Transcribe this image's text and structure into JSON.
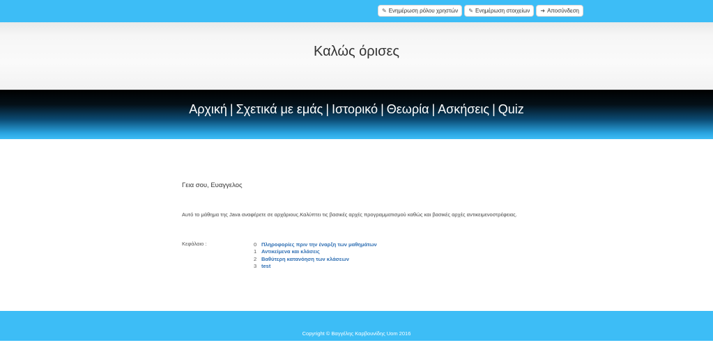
{
  "topbar": {
    "buttons": [
      {
        "label": "Ενημέρωση ρόλου χρηστών",
        "icon": "pencil-icon"
      },
      {
        "label": "Ενημέρωση στοιχείων",
        "icon": "pencil-icon"
      },
      {
        "label": "Αποσύνδεση",
        "icon": "logout-icon"
      }
    ],
    "color": "#3dbdf6"
  },
  "hero": {
    "title": "Καλώς όρισες"
  },
  "nav": {
    "items": [
      "Αρχική",
      "Σχετικά με εμάς",
      "Ιστορικό",
      "Θεωρία",
      "Ασκήσεις",
      "Quiz"
    ],
    "separator": "|"
  },
  "main": {
    "greeting": "Γεια σου, Ευαγγελος",
    "description": "Αυτό το μάθημα της Java αναφέρετε σε αρχάριους.Καλύπτει τις βασικές αρχές προγραμματισμού καθώς και βασικές αρχές αντικειμενοστρέφειας.",
    "chapters_label": "Κεφάλαιο :",
    "chapters": [
      {
        "num": "0",
        "title": "Πληροφορίες πριν την έναρξη των μαθημάτων"
      },
      {
        "num": "1",
        "title": "Αντικείμενα και κλάσεις"
      },
      {
        "num": "2",
        "title": "Βαθύτερη κατανόηση των κλάσεων"
      },
      {
        "num": "3",
        "title": "test"
      }
    ]
  },
  "footer": {
    "copyright": "Copyright © Βαγγέλης Καρβουνίδης Uom 2016"
  }
}
